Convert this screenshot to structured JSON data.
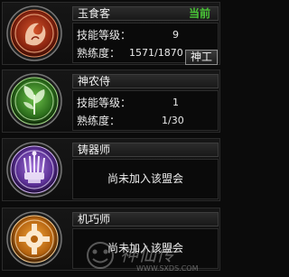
{
  "professions": [
    {
      "name": "玉食客",
      "status": "当前",
      "skill_level_label": "技能等级：",
      "skill_level": "9",
      "proficiency_label": "熟练度：",
      "proficiency": "1571/1870",
      "action_label": "神工",
      "icon": "red-phoenix-emblem-icon",
      "accent": "#c0391a"
    },
    {
      "name": "神农侍",
      "skill_level_label": "技能等级：",
      "skill_level": "1",
      "proficiency_label": "熟练度：",
      "proficiency": "1/30",
      "icon": "green-herb-emblem-icon",
      "accent": "#3f9a2c"
    },
    {
      "name": "铸器师",
      "message": "尚未加入该盟会",
      "icon": "purple-forge-emblem-icon",
      "accent": "#7a45b5"
    },
    {
      "name": "机巧师",
      "message": "尚未加入该盟会",
      "icon": "orange-gear-emblem-icon",
      "accent": "#d6841c"
    }
  ],
  "watermark": {
    "text_cn": "神仙传",
    "text_url": "WWW.SXDS.COM"
  }
}
